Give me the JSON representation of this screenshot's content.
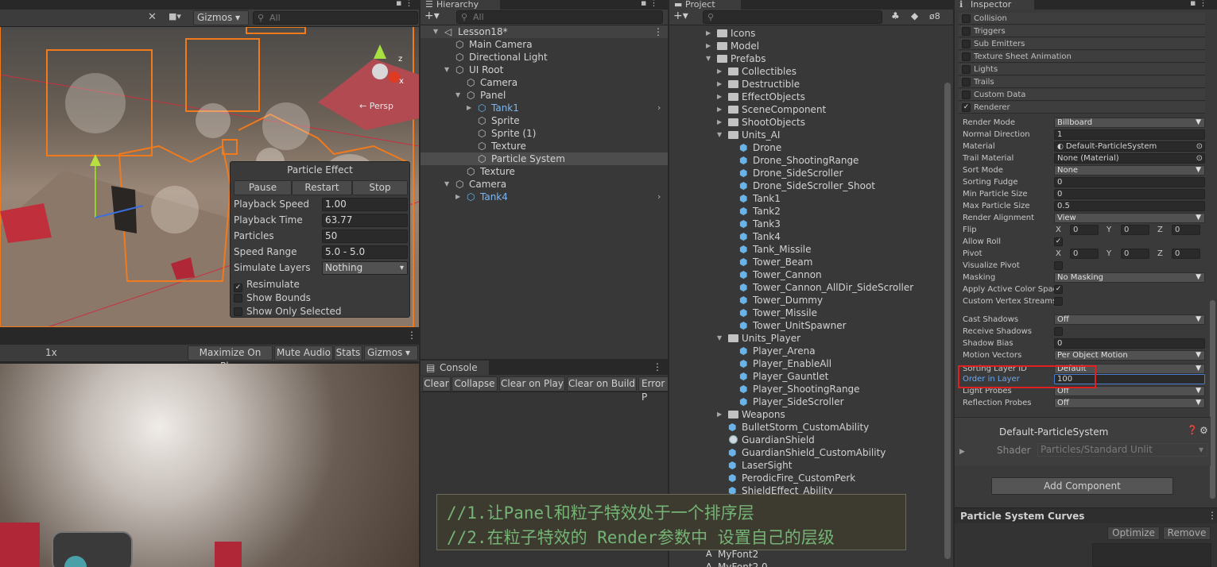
{
  "scene": {
    "gizmos_label": "Gizmos",
    "search_placeholder": "All",
    "persp_label": "← Persp",
    "axis_x": "x",
    "axis_z": "z",
    "particle_overlay": {
      "title": "Particle Effect",
      "buttons": [
        "Pause",
        "Restart",
        "Stop"
      ],
      "rows": [
        {
          "label": "Playback Speed",
          "value": "1.00"
        },
        {
          "label": "Playback Time",
          "value": "63.77"
        },
        {
          "label": "Particles",
          "value": "50"
        },
        {
          "label": "Speed Range",
          "value": "5.0 - 5.0"
        },
        {
          "label": "Simulate Layers",
          "value": "Nothing"
        }
      ],
      "checks": [
        {
          "label": "Resimulate",
          "checked": true
        },
        {
          "label": "Show Bounds",
          "checked": false
        },
        {
          "label": "Show Only Selected",
          "checked": false
        }
      ]
    }
  },
  "game": {
    "scale": "1x",
    "buttons": [
      "Maximize On Play",
      "Mute Audio",
      "Stats",
      "Gizmos"
    ]
  },
  "hierarchy": {
    "tab": "Hierarchy",
    "search_placeholder": "All",
    "items": [
      {
        "label": "Lesson18*",
        "depth": 0,
        "arrow": "open",
        "icon": "scene",
        "style": "scene"
      },
      {
        "label": "Main Camera",
        "depth": 1,
        "arrow": "",
        "icon": "cube",
        "style": ""
      },
      {
        "label": "Directional Light",
        "depth": 1,
        "arrow": "",
        "icon": "cube",
        "style": ""
      },
      {
        "label": "UI Root",
        "depth": 1,
        "arrow": "open",
        "icon": "cube",
        "style": ""
      },
      {
        "label": "Camera",
        "depth": 2,
        "arrow": "",
        "icon": "cube",
        "style": ""
      },
      {
        "label": "Panel",
        "depth": 2,
        "arrow": "open",
        "icon": "cube",
        "style": ""
      },
      {
        "label": "Tank1",
        "depth": 3,
        "arrow": "closed",
        "icon": "prefab",
        "style": "prefab",
        "more": true
      },
      {
        "label": "Sprite",
        "depth": 3,
        "arrow": "",
        "icon": "cube",
        "style": ""
      },
      {
        "label": "Sprite (1)",
        "depth": 3,
        "arrow": "",
        "icon": "cube",
        "style": ""
      },
      {
        "label": "Texture",
        "depth": 3,
        "arrow": "",
        "icon": "cube",
        "style": ""
      },
      {
        "label": "Particle System",
        "depth": 3,
        "arrow": "",
        "icon": "cube",
        "style": "selected"
      },
      {
        "label": "Texture",
        "depth": 2,
        "arrow": "",
        "icon": "cube",
        "style": ""
      },
      {
        "label": "Camera",
        "depth": 1,
        "arrow": "open",
        "icon": "cube",
        "style": ""
      },
      {
        "label": "Tank4",
        "depth": 2,
        "arrow": "closed",
        "icon": "prefab",
        "style": "prefab",
        "more": true
      }
    ]
  },
  "console": {
    "tab": "Console",
    "buttons": [
      "Clear",
      "Collapse",
      "Clear on Play",
      "Clear on Build",
      "Error P"
    ]
  },
  "project": {
    "tab": "Project",
    "hidden_count": "8",
    "items": [
      {
        "label": "Icons",
        "depth": 0,
        "arrow": "closed",
        "icon": "folder"
      },
      {
        "label": "Model",
        "depth": 0,
        "arrow": "closed",
        "icon": "folder"
      },
      {
        "label": "Prefabs",
        "depth": 0,
        "arrow": "open",
        "icon": "folder"
      },
      {
        "label": "Collectibles",
        "depth": 1,
        "arrow": "closed",
        "icon": "folder"
      },
      {
        "label": "Destructible",
        "depth": 1,
        "arrow": "closed",
        "icon": "folder"
      },
      {
        "label": "EffectObjects",
        "depth": 1,
        "arrow": "closed",
        "icon": "folder"
      },
      {
        "label": "SceneComponent",
        "depth": 1,
        "arrow": "closed",
        "icon": "folder"
      },
      {
        "label": "ShootObjects",
        "depth": 1,
        "arrow": "closed",
        "icon": "folder"
      },
      {
        "label": "Units_AI",
        "depth": 1,
        "arrow": "open",
        "icon": "folder"
      },
      {
        "label": "Drone",
        "depth": 2,
        "arrow": "",
        "icon": "prefab"
      },
      {
        "label": "Drone_ShootingRange",
        "depth": 2,
        "arrow": "",
        "icon": "prefab"
      },
      {
        "label": "Drone_SideScroller",
        "depth": 2,
        "arrow": "",
        "icon": "prefab"
      },
      {
        "label": "Drone_SideScroller_Shoot",
        "depth": 2,
        "arrow": "",
        "icon": "prefab"
      },
      {
        "label": "Tank1",
        "depth": 2,
        "arrow": "",
        "icon": "prefab"
      },
      {
        "label": "Tank2",
        "depth": 2,
        "arrow": "",
        "icon": "prefab"
      },
      {
        "label": "Tank3",
        "depth": 2,
        "arrow": "",
        "icon": "prefab"
      },
      {
        "label": "Tank4",
        "depth": 2,
        "arrow": "",
        "icon": "prefab"
      },
      {
        "label": "Tank_Missile",
        "depth": 2,
        "arrow": "",
        "icon": "prefab"
      },
      {
        "label": "Tower_Beam",
        "depth": 2,
        "arrow": "",
        "icon": "prefab"
      },
      {
        "label": "Tower_Cannon",
        "depth": 2,
        "arrow": "",
        "icon": "prefab"
      },
      {
        "label": "Tower_Cannon_AllDir_SideScroller",
        "depth": 2,
        "arrow": "",
        "icon": "prefab"
      },
      {
        "label": "Tower_Dummy",
        "depth": 2,
        "arrow": "",
        "icon": "prefab"
      },
      {
        "label": "Tower_Missile",
        "depth": 2,
        "arrow": "",
        "icon": "prefab"
      },
      {
        "label": "Tower_UnitSpawner",
        "depth": 2,
        "arrow": "",
        "icon": "prefab"
      },
      {
        "label": "Units_Player",
        "depth": 1,
        "arrow": "open",
        "icon": "folder"
      },
      {
        "label": "Player_Arena",
        "depth": 2,
        "arrow": "",
        "icon": "prefab"
      },
      {
        "label": "Player_EnableAll",
        "depth": 2,
        "arrow": "",
        "icon": "prefab"
      },
      {
        "label": "Player_Gauntlet",
        "depth": 2,
        "arrow": "",
        "icon": "prefab"
      },
      {
        "label": "Player_ShootingRange",
        "depth": 2,
        "arrow": "",
        "icon": "prefab"
      },
      {
        "label": "Player_SideScroller",
        "depth": 2,
        "arrow": "",
        "icon": "prefab"
      },
      {
        "label": "Weapons",
        "depth": 1,
        "arrow": "closed",
        "icon": "folder"
      },
      {
        "label": "BulletStorm_CustomAbility",
        "depth": 1,
        "arrow": "",
        "icon": "prefab"
      },
      {
        "label": "GuardianShield",
        "depth": 1,
        "arrow": "",
        "icon": "sphere"
      },
      {
        "label": "GuardianShield_CustomAbility",
        "depth": 1,
        "arrow": "",
        "icon": "prefab"
      },
      {
        "label": "LaserSight",
        "depth": 1,
        "arrow": "",
        "icon": "prefab"
      },
      {
        "label": "PerodicFire_CustomPerk",
        "depth": 1,
        "arrow": "",
        "icon": "prefab"
      },
      {
        "label": "ShieldEffect_Ability",
        "depth": 1,
        "arrow": "",
        "icon": "prefab"
      }
    ],
    "bottom_items": [
      "MyFont2",
      "MyFont2 0"
    ]
  },
  "annotation": {
    "line1": "//1.让Panel和粒子特效处于一个排序层",
    "line2": "//2.在粒子特效的 Render参数中 设置自己的层级"
  },
  "inspector": {
    "tab": "Inspector",
    "modules": [
      {
        "label": "Collision",
        "checked": false
      },
      {
        "label": "Triggers",
        "checked": false
      },
      {
        "label": "Sub Emitters",
        "checked": false
      },
      {
        "label": "Texture Sheet Animation",
        "checked": false
      },
      {
        "label": "Lights",
        "checked": false
      },
      {
        "label": "Trails",
        "checked": false
      },
      {
        "label": "Custom Data",
        "checked": false
      },
      {
        "label": "Renderer",
        "checked": true
      }
    ],
    "renderer_rows": [
      {
        "label": "Render Mode",
        "kind": "drop",
        "value": "Billboard"
      },
      {
        "label": "Normal Direction",
        "kind": "field",
        "value": "1"
      },
      {
        "label": "Material",
        "kind": "object",
        "value": "Default-ParticleSystem"
      },
      {
        "label": "Trail Material",
        "kind": "object",
        "value": "None (Material)"
      },
      {
        "label": "Sort Mode",
        "kind": "drop",
        "value": "None"
      },
      {
        "label": "Sorting Fudge",
        "kind": "field",
        "value": "0"
      },
      {
        "label": "Min Particle Size",
        "kind": "field",
        "value": "0"
      },
      {
        "label": "Max Particle Size",
        "kind": "field",
        "value": "0.5"
      },
      {
        "label": "Render Alignment",
        "kind": "drop",
        "value": "View"
      },
      {
        "label": "Flip",
        "kind": "xyz",
        "x": "0",
        "y": "0",
        "z": "0"
      },
      {
        "label": "Allow Roll",
        "kind": "check",
        "checked": true
      },
      {
        "label": "Pivot",
        "kind": "xyz",
        "x": "0",
        "y": "0",
        "z": "0"
      },
      {
        "label": "Visualize Pivot",
        "kind": "check",
        "checked": false
      },
      {
        "label": "Masking",
        "kind": "drop",
        "value": "No Masking"
      },
      {
        "label": "Apply Active Color Spac",
        "kind": "check",
        "checked": true
      },
      {
        "label": "Custom Vertex Streams",
        "kind": "check",
        "checked": false
      },
      {
        "label": "Cast Shadows",
        "kind": "drop",
        "value": "Off"
      },
      {
        "label": "Receive Shadows",
        "kind": "check",
        "checked": false
      },
      {
        "label": "Shadow Bias",
        "kind": "field",
        "value": "0"
      },
      {
        "label": "Motion Vectors",
        "kind": "drop",
        "value": "Per Object Motion"
      },
      {
        "label": "Sorting Layer ID",
        "kind": "drop",
        "value": "Default"
      },
      {
        "label": "Order in Layer",
        "kind": "field",
        "value": "100",
        "active": true
      },
      {
        "label": "Light Probes",
        "kind": "drop",
        "value": "Off"
      },
      {
        "label": "Reflection Probes",
        "kind": "drop",
        "value": "Off"
      }
    ],
    "material": {
      "name": "Default-ParticleSystem",
      "shader_label": "Shader",
      "shader_value": "Particles/Standard Unlit"
    },
    "add_component": "Add Component",
    "curves": {
      "title": "Particle System Curves",
      "optimize": "Optimize",
      "remove": "Remove"
    }
  },
  "colors": {
    "selection_outline": "#f07a1c",
    "highlight_box": "#e02020",
    "prefab_text": "#7cb6f0"
  }
}
